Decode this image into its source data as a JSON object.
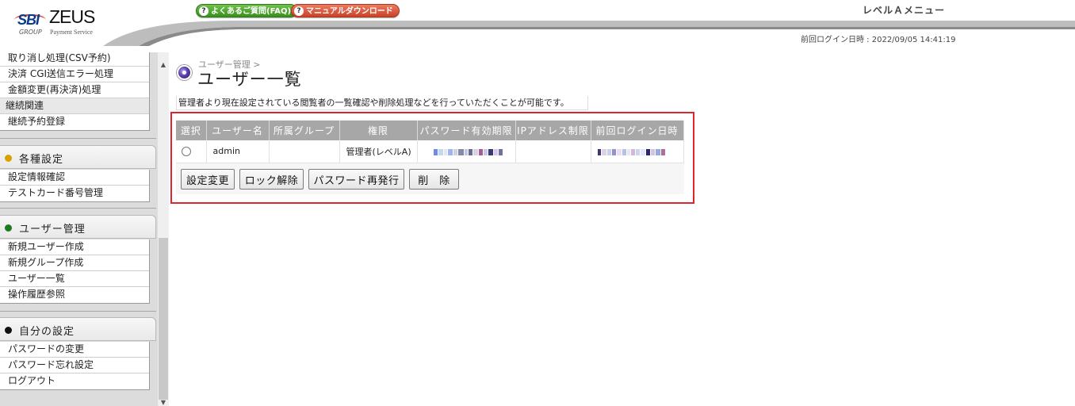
{
  "header": {
    "logo_sbi": "SBI",
    "logo_group": "GROUP",
    "logo_zeus": "ZEUS",
    "logo_service": "Payment Service",
    "faq_label": "よくあるご質問(FAQ)",
    "manual_label": "マニュアルダウンロード",
    "level_menu": "レベルＡメニュー",
    "last_login": "前回ログイン日時 : 2022/09/05 14:41:19"
  },
  "sidebar": {
    "top_items": [
      {
        "label": "取り消し処理(CSV予約)"
      },
      {
        "label": "決済 CGI送信エラー処理"
      },
      {
        "label": "金額変更(再決済)処理"
      },
      {
        "label": "継続関連"
      },
      {
        "label": "継続予約登録"
      }
    ],
    "sections": [
      {
        "title": "各種設定",
        "dot_color": "#d9a100",
        "items": [
          {
            "label": "設定情報確認"
          },
          {
            "label": "テストカード番号管理"
          }
        ]
      },
      {
        "title": "ユーザー管理",
        "dot_color": "#1f7a1f",
        "items": [
          {
            "label": "新規ユーザー作成"
          },
          {
            "label": "新規グループ作成"
          },
          {
            "label": "ユーザー一覧"
          },
          {
            "label": "操作履歴参照"
          }
        ]
      },
      {
        "title": "自分の設定",
        "dot_color": "#111111",
        "items": [
          {
            "label": "パスワードの変更"
          },
          {
            "label": "パスワード忘れ設定"
          },
          {
            "label": "ログアウト"
          }
        ]
      }
    ]
  },
  "main": {
    "breadcrumb": "ユーザー管理 >",
    "title": "ユーザー一覧",
    "description": "管理者より現在設定されている閲覧者の一覧確認や削除処理などを行っていただくことが可能です。",
    "table": {
      "headers": [
        "選択",
        "ユーザー名",
        "所属グループ",
        "権限",
        "パスワード有効期限",
        "IPアドレス制限",
        "前回ログイン日時"
      ],
      "rows": [
        {
          "username": "admin",
          "group": "",
          "role": "管理者(レベルA)",
          "ip": ""
        }
      ]
    },
    "buttons": {
      "change": "設定変更",
      "unlock": "ロック解除",
      "reissue": "パスワード再発行",
      "delete": "削　除"
    }
  },
  "colors": {
    "highlight": "#e0242e",
    "table_header": "#a7a7a7"
  }
}
